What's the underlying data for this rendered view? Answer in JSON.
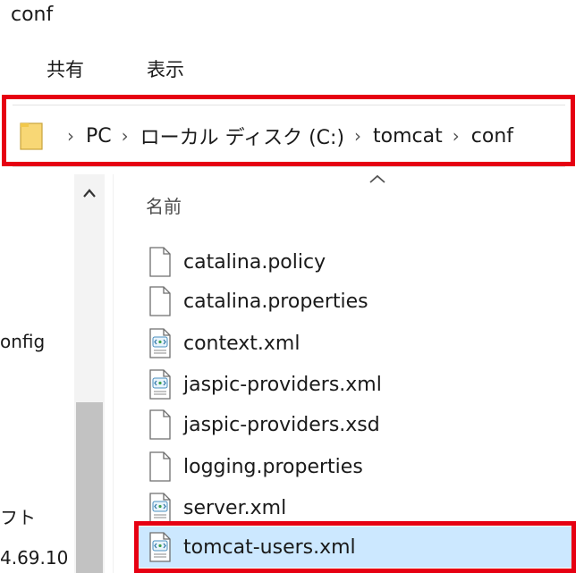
{
  "window": {
    "title": "conf"
  },
  "ribbon": {
    "tabs": [
      {
        "label": "共有"
      },
      {
        "label": "表示"
      }
    ]
  },
  "address_bar": {
    "breadcrumbs": [
      {
        "label": "PC"
      },
      {
        "label": "ローカル ディスク (C:)"
      },
      {
        "label": "tomcat"
      },
      {
        "label": "conf"
      }
    ],
    "separator": "›"
  },
  "nav_pane": {
    "items": [
      {
        "label": "onfig"
      },
      {
        "label": "フト"
      },
      {
        "label": "4.69.10"
      }
    ]
  },
  "file_list": {
    "column_header": "名前",
    "files": [
      {
        "name": "catalina.policy",
        "icon": "document-icon"
      },
      {
        "name": "catalina.properties",
        "icon": "document-icon"
      },
      {
        "name": "context.xml",
        "icon": "xml-file-icon"
      },
      {
        "name": "jaspic-providers.xml",
        "icon": "xml-file-icon"
      },
      {
        "name": "jaspic-providers.xsd",
        "icon": "document-icon"
      },
      {
        "name": "logging.properties",
        "icon": "document-icon"
      },
      {
        "name": "server.xml",
        "icon": "xml-file-icon"
      },
      {
        "name": "tomcat-users.xml",
        "icon": "xml-file-icon",
        "selected": true
      }
    ]
  },
  "colors": {
    "highlight_border": "#e60012",
    "selection_background": "#cce8ff",
    "folder_yellow": "#f8d775"
  }
}
